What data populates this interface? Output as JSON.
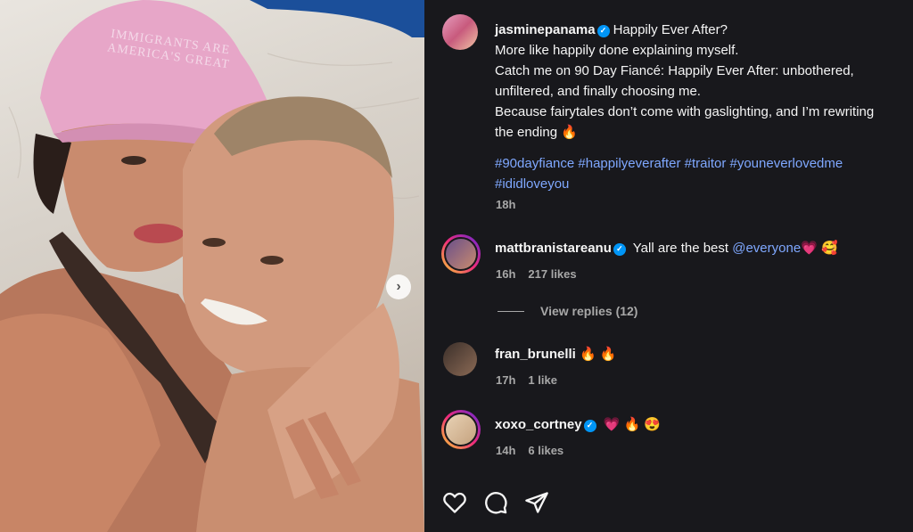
{
  "post": {
    "author": "jasminepanama",
    "caption_lines": [
      "Happily Ever After?",
      "More like happily done explaining myself.",
      "Catch me on 90 Day Fiancé: Happily Ever After: unbothered,",
      "unfiltered, and finally choosing me.",
      "Because fairytales don’t come with gaslighting, and I’m rewriting",
      "the ending 🔥"
    ],
    "hashtags_line1": "#90dayfiance #happilyeverafter #traitor #youneverlovedme",
    "hashtags_line2": "#ididloveyou",
    "time": "18h",
    "photo_cap_text": "IMMIGRANTS ARE AMERICA'S GREAT"
  },
  "comments": [
    {
      "user": "mattbranistareanu",
      "verified": true,
      "text": "Yall are the best ",
      "mention": "@everyone",
      "emoji": "💗 🥰",
      "time": "16h",
      "likes": "217 likes"
    },
    {
      "user": "fran_brunelli",
      "verified": false,
      "text": "",
      "emoji": "🔥 🔥",
      "time": "17h",
      "likes": "1 like"
    },
    {
      "user": "xoxo_cortney",
      "verified": true,
      "text": "",
      "emoji": "💗 🔥 😍",
      "time": "14h",
      "likes": "6 likes"
    }
  ],
  "view_replies": "View replies (12)",
  "icons": [
    "heart-icon",
    "comment-icon",
    "share-icon",
    "chevron-right-icon",
    "verified-icon"
  ],
  "colors": {
    "panel_bg": "#18181c",
    "link": "#7fa8ff",
    "verified": "#0095f6",
    "muted": "#a8a8a8"
  }
}
